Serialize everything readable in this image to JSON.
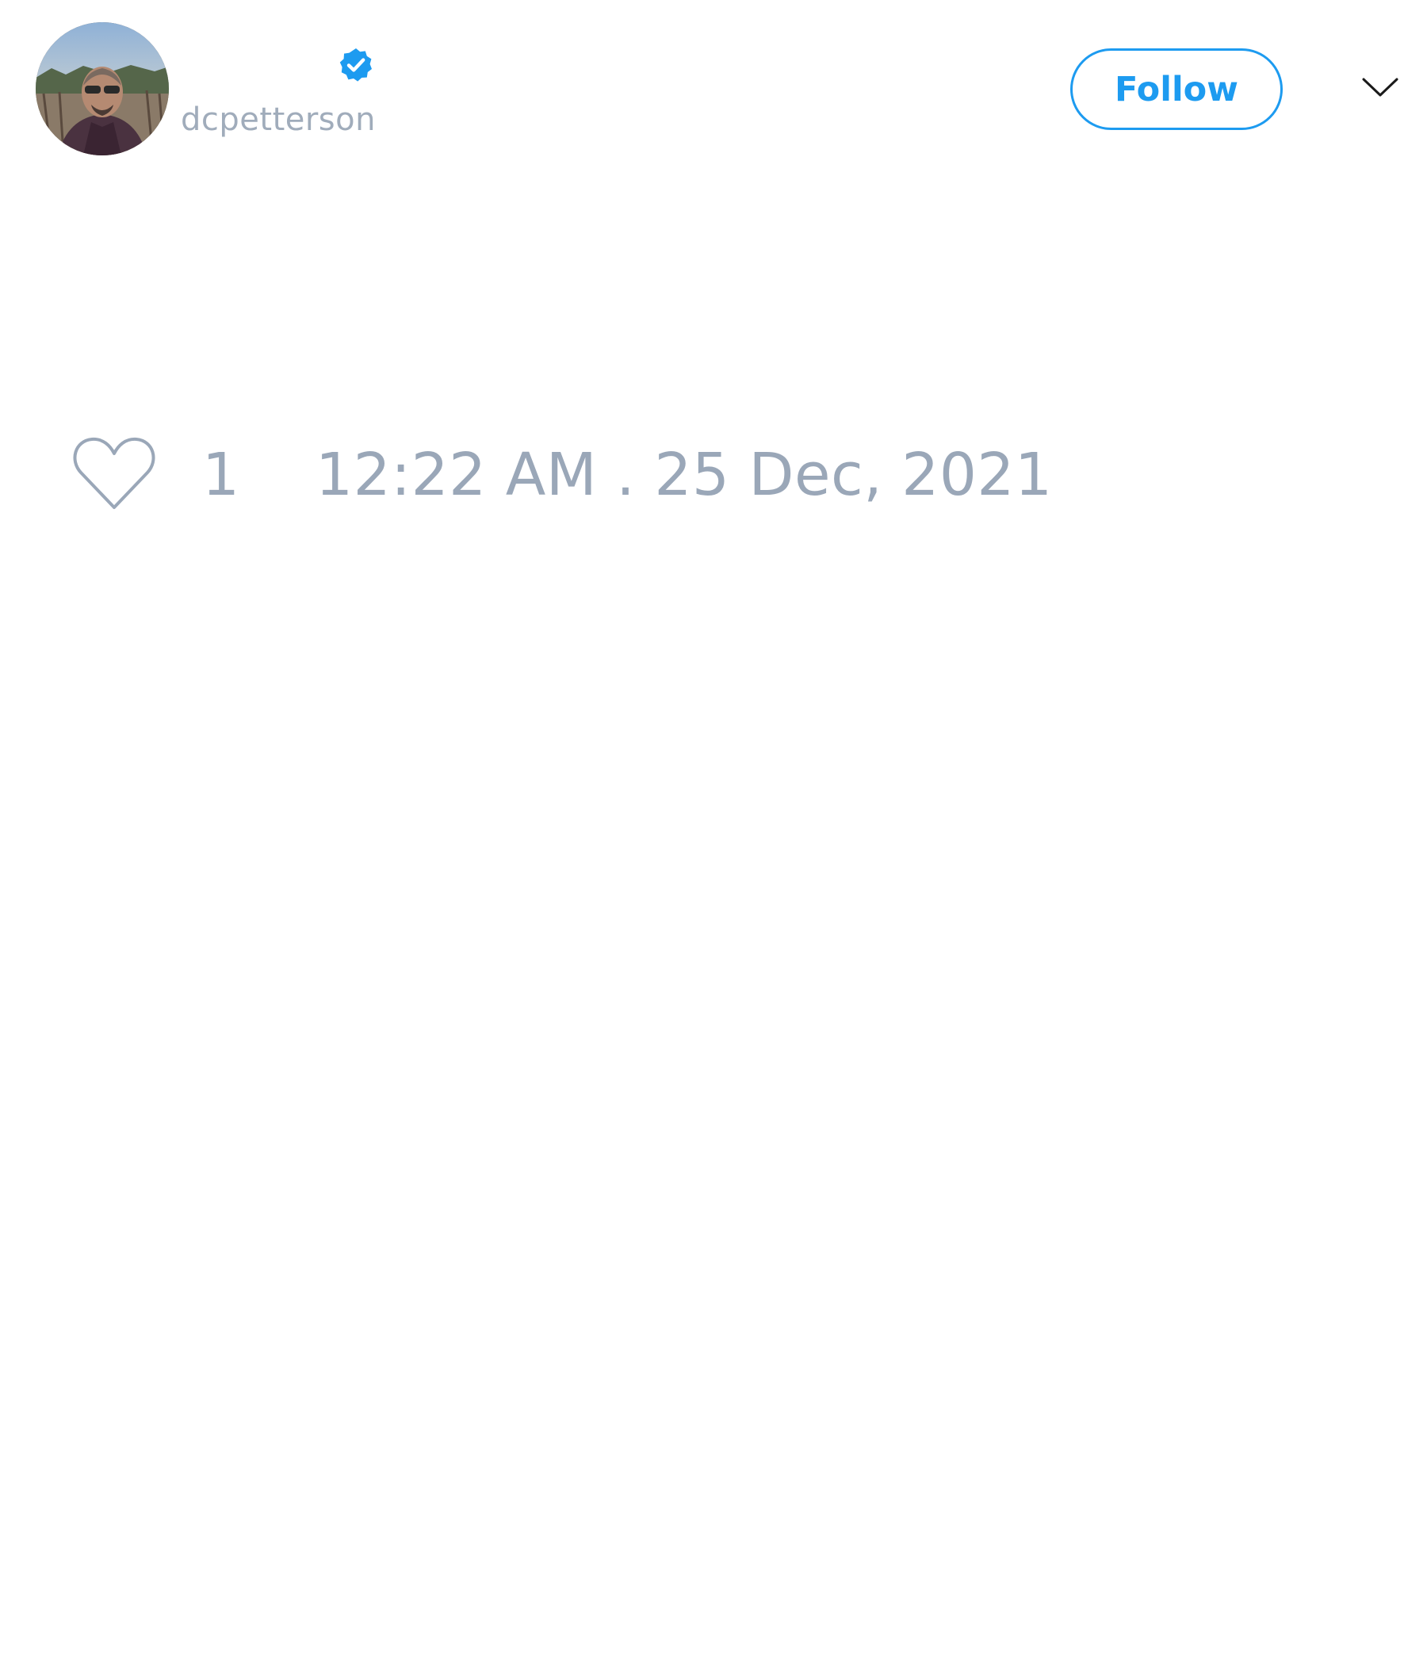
{
  "tweet": {
    "author": {
      "display_name": "",
      "handle": "dcpetterson",
      "verified": true,
      "avatar": "profile-photo"
    },
    "follow_label": "Follow",
    "more_icon": "chevron-down-icon",
    "like_icon": "heart-outline-icon",
    "like_count": "1",
    "timestamp": "12:22 AM . 25 Dec, 2021"
  },
  "colors": {
    "accent": "#1d9bf0",
    "muted_text": "#9aa7b8",
    "background": "#ffffff"
  }
}
